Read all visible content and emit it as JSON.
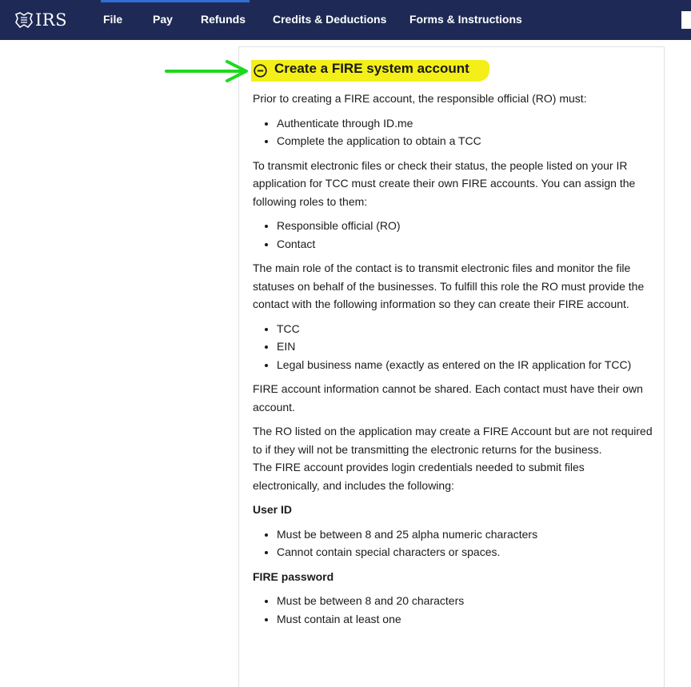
{
  "header": {
    "logo_text": "IRS",
    "nav": [
      "File",
      "Pay",
      "Refunds",
      "Credits & Deductions",
      "Forms & Instructions"
    ]
  },
  "accordion": {
    "title": "Create a FIRE system account",
    "icon": "minus-circle-icon"
  },
  "annotations": {
    "arrow_color": "#1ed81e",
    "highlight_color": "#f4ef18"
  },
  "content": {
    "intro": "Prior to creating a FIRE account, the responsible official (RO) must:",
    "ro_must": [
      "Authenticate through ID.me",
      "Complete the application to obtain a TCC"
    ],
    "transmit_para": "To transmit electronic files or check their status, the people listed on your IR application for TCC must create their own FIRE accounts. You can assign the following roles to them:",
    "roles": [
      "Responsible official (RO)",
      "Contact"
    ],
    "contact_para": "The main role of the contact is to transmit electronic files and monitor the file statuses on behalf of the businesses. To fulfill this role the RO must provide the contact with the following information so they can create their FIRE account.",
    "info_items": [
      "TCC",
      "EIN",
      "Legal business name (exactly as entered on the IR application for TCC)"
    ],
    "shared_para": "FIRE account information cannot be shared. Each contact must have their own account.",
    "ro_para": "The RO listed on the application may create a FIRE Account but are not required to if they will not be transmitting the electronic returns for the business.",
    "provides_para": "The FIRE account provides login credentials needed to submit files electronically, and includes the following:",
    "userid_heading": "User ID",
    "userid_rules": [
      "Must be between 8 and 25 alpha numeric characters",
      "Cannot contain special characters or spaces."
    ],
    "password_heading": "FIRE password",
    "password_rules": [
      "Must be between 8 and 20 characters",
      "Must contain at least one"
    ]
  }
}
